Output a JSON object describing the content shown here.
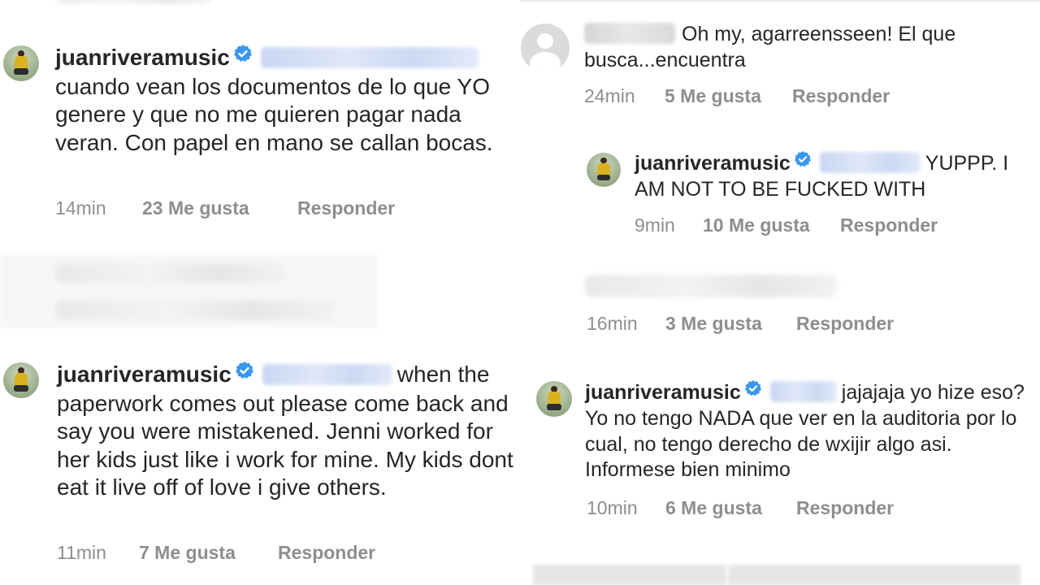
{
  "left": {
    "comment1": {
      "username": "juanriveramusic",
      "text_after": "cuando vean los documentos de lo que YO genere y que no me quieren pagar nada veran. Con papel en mano se callan bocas.",
      "time": "14min",
      "likes": "23 Me gusta",
      "reply": "Responder"
    },
    "comment2": {
      "username": "juanriveramusic",
      "text_after": "when the paperwork comes out please come back and say you were mistakened. Jenni worked for her kids just like i work for mine. My kids dont eat it live off of love i give others.",
      "time": "11min",
      "likes": "7 Me gusta",
      "reply": "Responder"
    }
  },
  "right": {
    "comment1": {
      "text_after": "Oh my, agarreensseen! El que busca...encuentra",
      "time": "24min",
      "likes": "5 Me gusta",
      "reply": "Responder"
    },
    "comment2": {
      "username": "juanriveramusic",
      "text_after": "YUPPP. I AM NOT TO BE FUCKED WITH",
      "time": "9min",
      "likes": "10 Me gusta",
      "reply": "Responder"
    },
    "comment3": {
      "time": "16min",
      "likes": "3 Me gusta",
      "reply": "Responder"
    },
    "comment4": {
      "username": "juanriveramusic",
      "text_after": "jajajaja yo hize eso? Yo no tengo NADA que ver en la auditoria por lo cual, no tengo derecho de wxijir algo asi. Informese bien minimo",
      "time": "10min",
      "likes": "6 Me gusta",
      "reply": "Responder"
    }
  },
  "colors": {
    "verified": "#3897f0",
    "meta_gray": "#8e8e8e",
    "text": "#262626"
  },
  "icons": {
    "verified": "verified-badge-icon",
    "default_avatar": "default-user-avatar-icon"
  }
}
